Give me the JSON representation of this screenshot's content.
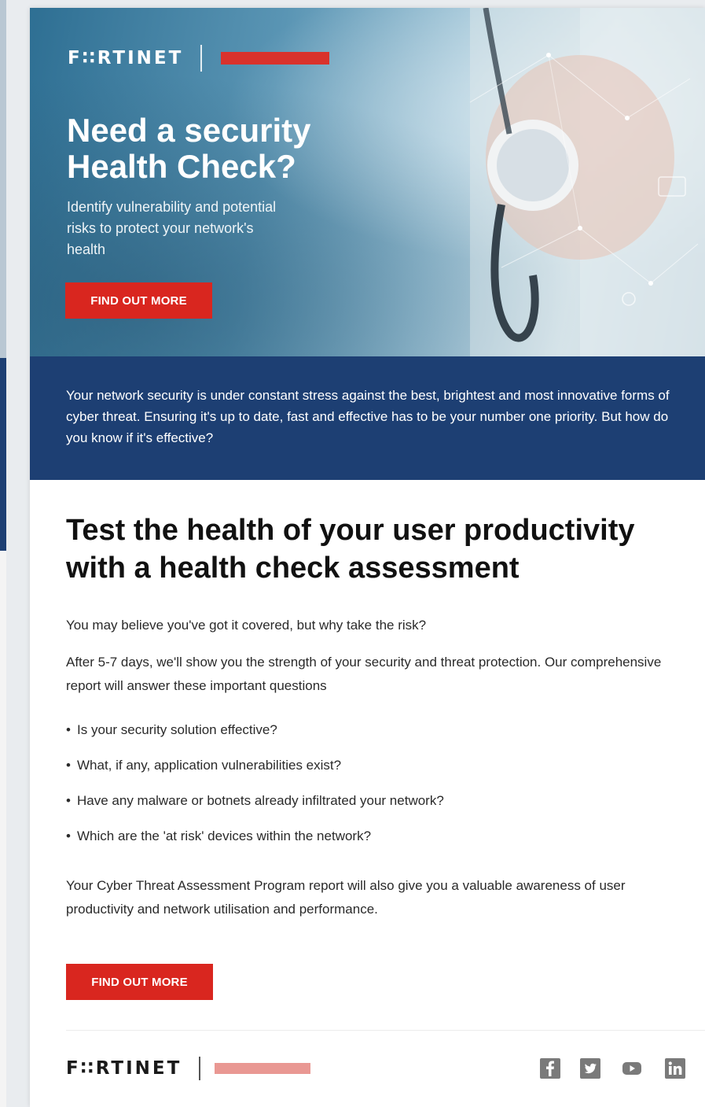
{
  "hero": {
    "logo_text": "F∷RTINET",
    "tag_text": "",
    "title": "Need a security Health Check?",
    "subtitle": "Identify vulnerability and potential risks to protect your network's health",
    "button_label": "FIND OUT MORE"
  },
  "band": {
    "text": "Your network security is under constant stress against the best, brightest and most innovative forms of cyber threat. Ensuring it's up to date, fast and effective has to be your number one priority. But how do you know if it's effective?"
  },
  "main": {
    "title": "Test the health of your user productivity with a health check assessment",
    "para1": "You may believe you've got it covered, but why take the risk?",
    "para2": "After 5-7 days, we'll show you the strength of your security and threat protection. Our comprehensive report will answer these important questions",
    "bullets": [
      "Is your security solution effective?",
      "What, if any, application vulnerabilities exist?",
      "Have any malware or botnets already infiltrated your network?",
      "Which are the 'at risk' devices within the network?"
    ],
    "bullet_symbol": "•",
    "para3": "Your Cyber Threat Assessment Program report will also give you a valuable awareness of user productivity and network utilisation and performance.",
    "button_label": "FIND OUT MORE"
  },
  "footer": {
    "logo_text": "F∷RTINET",
    "tag_text": "",
    "social_icons": [
      "facebook-icon",
      "twitter-icon",
      "youtube-icon",
      "linkedin-icon"
    ]
  },
  "colors": {
    "accent_red": "#d9261f",
    "band_blue": "#1d3f73",
    "social_gray": "#7a7a7a"
  }
}
